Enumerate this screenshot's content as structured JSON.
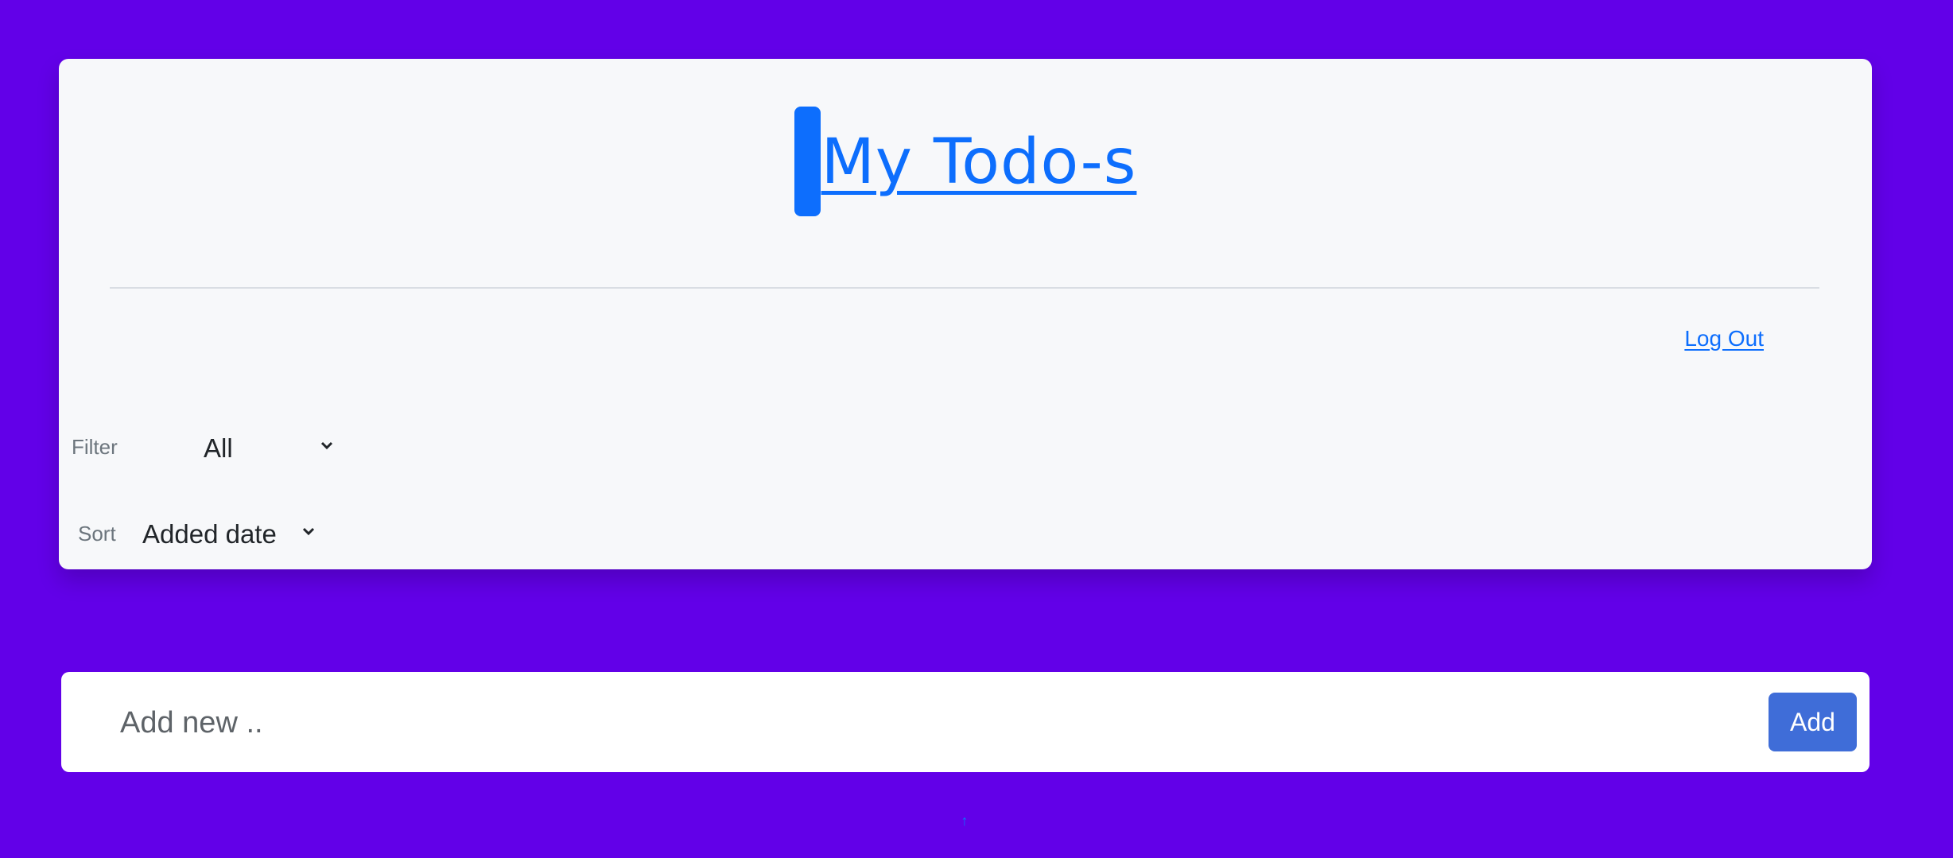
{
  "app": {
    "title": "My Todo-s"
  },
  "header": {
    "logout_label": "Log Out"
  },
  "controls": {
    "filter_label": "Filter",
    "filter_value": "All",
    "sort_label": "Sort",
    "sort_value": "Added date"
  },
  "add_todo": {
    "placeholder": "Add new ..",
    "button_label": "Add"
  },
  "icons": {
    "chevron": "chevron-down-icon",
    "scroll_top": "arrow-up-icon"
  },
  "colors": {
    "background": "#6200E8",
    "card": "#F7F8FA",
    "link": "#0D6EFD",
    "button": "#3F6DD8"
  }
}
